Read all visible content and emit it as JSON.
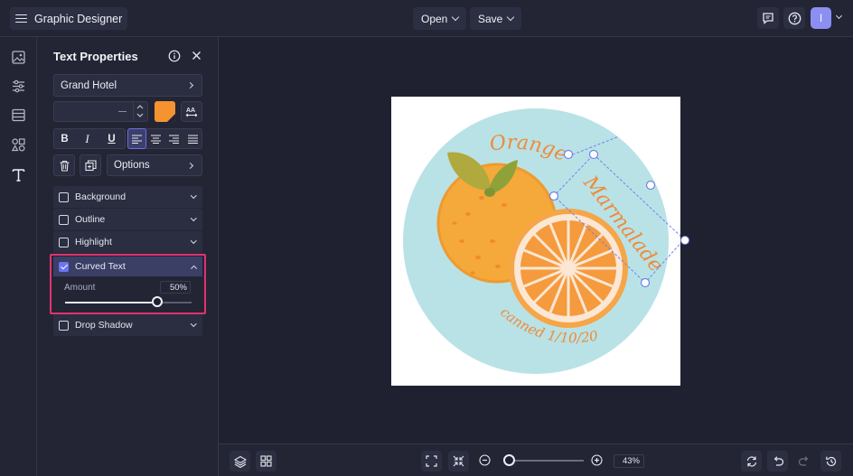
{
  "app": {
    "title": "Graphic Designer"
  },
  "topbar": {
    "open_label": "Open",
    "save_label": "Save",
    "avatar_initial": "I"
  },
  "panel": {
    "title": "Text Properties",
    "font_name": "Grand Hotel",
    "font_size_placeholder": "—",
    "text_color": "#f59331",
    "options_label": "Options",
    "accordion": {
      "background": {
        "label": "Background",
        "checked": false
      },
      "outline": {
        "label": "Outline",
        "checked": false
      },
      "highlight": {
        "label": "Highlight",
        "checked": false
      },
      "curved_text": {
        "label": "Curved Text",
        "checked": true,
        "amount_label": "Amount",
        "amount_value": "50%",
        "amount_fraction": 0.73
      },
      "drop_shadow": {
        "label": "Drop Shadow",
        "checked": false
      }
    }
  },
  "canvas": {
    "label_top": "Orange",
    "label_curved": "Marmalade",
    "label_bottom": "canned 1/10/20",
    "colors": {
      "circle": "#b9e2e6",
      "orange": "#f5a93a",
      "text": "#ee8b3a",
      "slice_rind": "#fbe7d4"
    }
  },
  "bottombar": {
    "zoom_value": "43%",
    "zoom_fraction": 0.03
  },
  "icons": [
    "menu-icon",
    "chevron-down-icon",
    "comment-icon",
    "help-icon",
    "image-icon",
    "sliders-icon",
    "layout-icon",
    "shapes-icon",
    "text-icon",
    "info-icon",
    "close-icon",
    "text-fit-icon",
    "trash-icon",
    "duplicate-icon",
    "layers-icon",
    "grid-icon",
    "fit-screen-icon",
    "shrink-icon",
    "zoom-out-icon",
    "zoom-in-icon",
    "refresh-icon",
    "undo-icon",
    "redo-icon",
    "history-icon"
  ]
}
